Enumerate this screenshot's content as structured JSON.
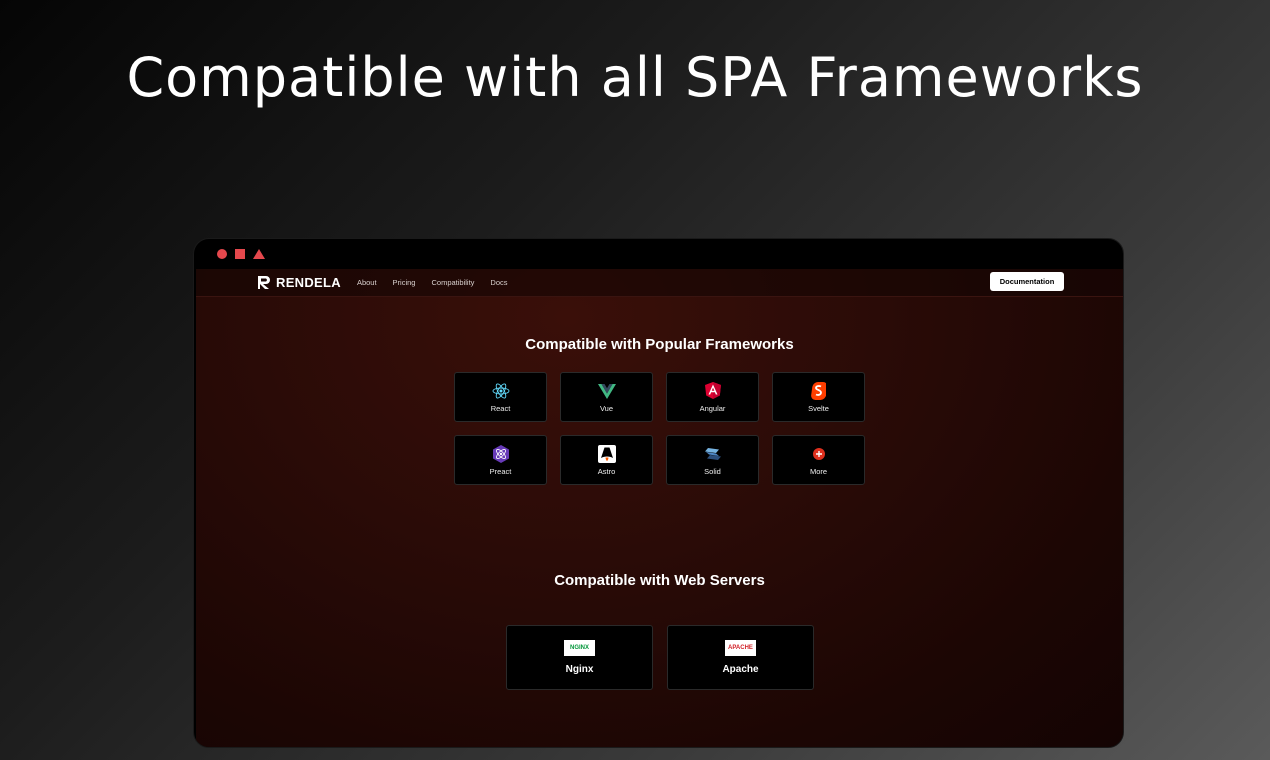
{
  "headline": "Compatible with all SPA Frameworks",
  "navbar": {
    "brand": "RENDELA",
    "links": [
      "About",
      "Pricing",
      "Compatibility",
      "Docs"
    ],
    "cta": "Documentation"
  },
  "frameworks": {
    "title": "Compatible with Popular Frameworks",
    "items": [
      {
        "label": "React",
        "icon": "react-icon",
        "color": "#61dafb"
      },
      {
        "label": "Vue",
        "icon": "vue-icon",
        "color": "#41b883"
      },
      {
        "label": "Angular",
        "icon": "angular-icon",
        "color": "#dd0031"
      },
      {
        "label": "Svelte",
        "icon": "svelte-icon",
        "color": "#ff3e00"
      },
      {
        "label": "Preact",
        "icon": "preact-icon",
        "color": "#673ab8"
      },
      {
        "label": "Astro",
        "icon": "astro-icon",
        "color": "#ffffff"
      },
      {
        "label": "Solid",
        "icon": "solid-icon",
        "color": "#4f88c6"
      },
      {
        "label": "More",
        "icon": "more-icon",
        "color": "#e0301e"
      }
    ]
  },
  "servers": {
    "title": "Compatible with Web Servers",
    "items": [
      {
        "label": "Nginx",
        "logo_text": "NGINX",
        "color": "#009639"
      },
      {
        "label": "Apache",
        "logo_text": "APACHE",
        "color": "#d22128"
      }
    ]
  },
  "colors": {
    "accent": "#e5484d"
  }
}
